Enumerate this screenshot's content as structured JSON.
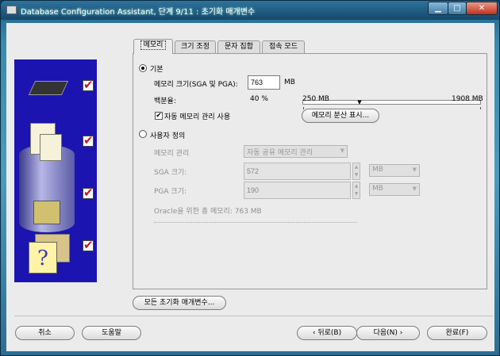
{
  "window": {
    "title": "Database Configuration Assistant, 단계 9/11 : 초기화 매개변수",
    "min": "▁",
    "max": "□",
    "close": "✕"
  },
  "tabs": [
    {
      "label": "메모리",
      "active": true
    },
    {
      "label": "크기 조정"
    },
    {
      "label": "문자 집합"
    },
    {
      "label": "접속 모드"
    }
  ],
  "memory": {
    "basic_label": "기본",
    "size_label": "메모리 크기(SGA 및 PGA):",
    "size_value": "763",
    "size_unit": "MB",
    "percent_label": "백분율:",
    "percent_value": "40 %",
    "slider_min": "250 MB",
    "slider_max": "1908 MB",
    "slider_value_mb": 763,
    "auto_mgmt_label": "자동 메모리 관리 사용",
    "show_dist_button": "메모리 분산 표시...",
    "custom_label": "사용자 정의",
    "mgmt_label": "메모리 관리",
    "mgmt_value": "자동 공유 메모리 관리",
    "sga_label": "SGA 크기:",
    "sga_value": "572",
    "sga_unit": "MB",
    "pga_label": "PGA 크기:",
    "pga_value": "190",
    "pga_unit": "MB",
    "total_label": "Oracle을 위한 총 메모리:",
    "total_value": "763 MB"
  },
  "all_params_button": "모든 초기화 매개변수...",
  "footer": {
    "cancel": "취소",
    "help": "도움말",
    "back": "뒤로(B)",
    "next": "다음(N)",
    "finish": "완료(F)"
  },
  "icons": {
    "check": "✔",
    "chevron_left": "‹",
    "chevron_right": "›",
    "combo_arrow": "▼",
    "spin_up": "▲",
    "spin_down": "▼",
    "question": "?"
  }
}
